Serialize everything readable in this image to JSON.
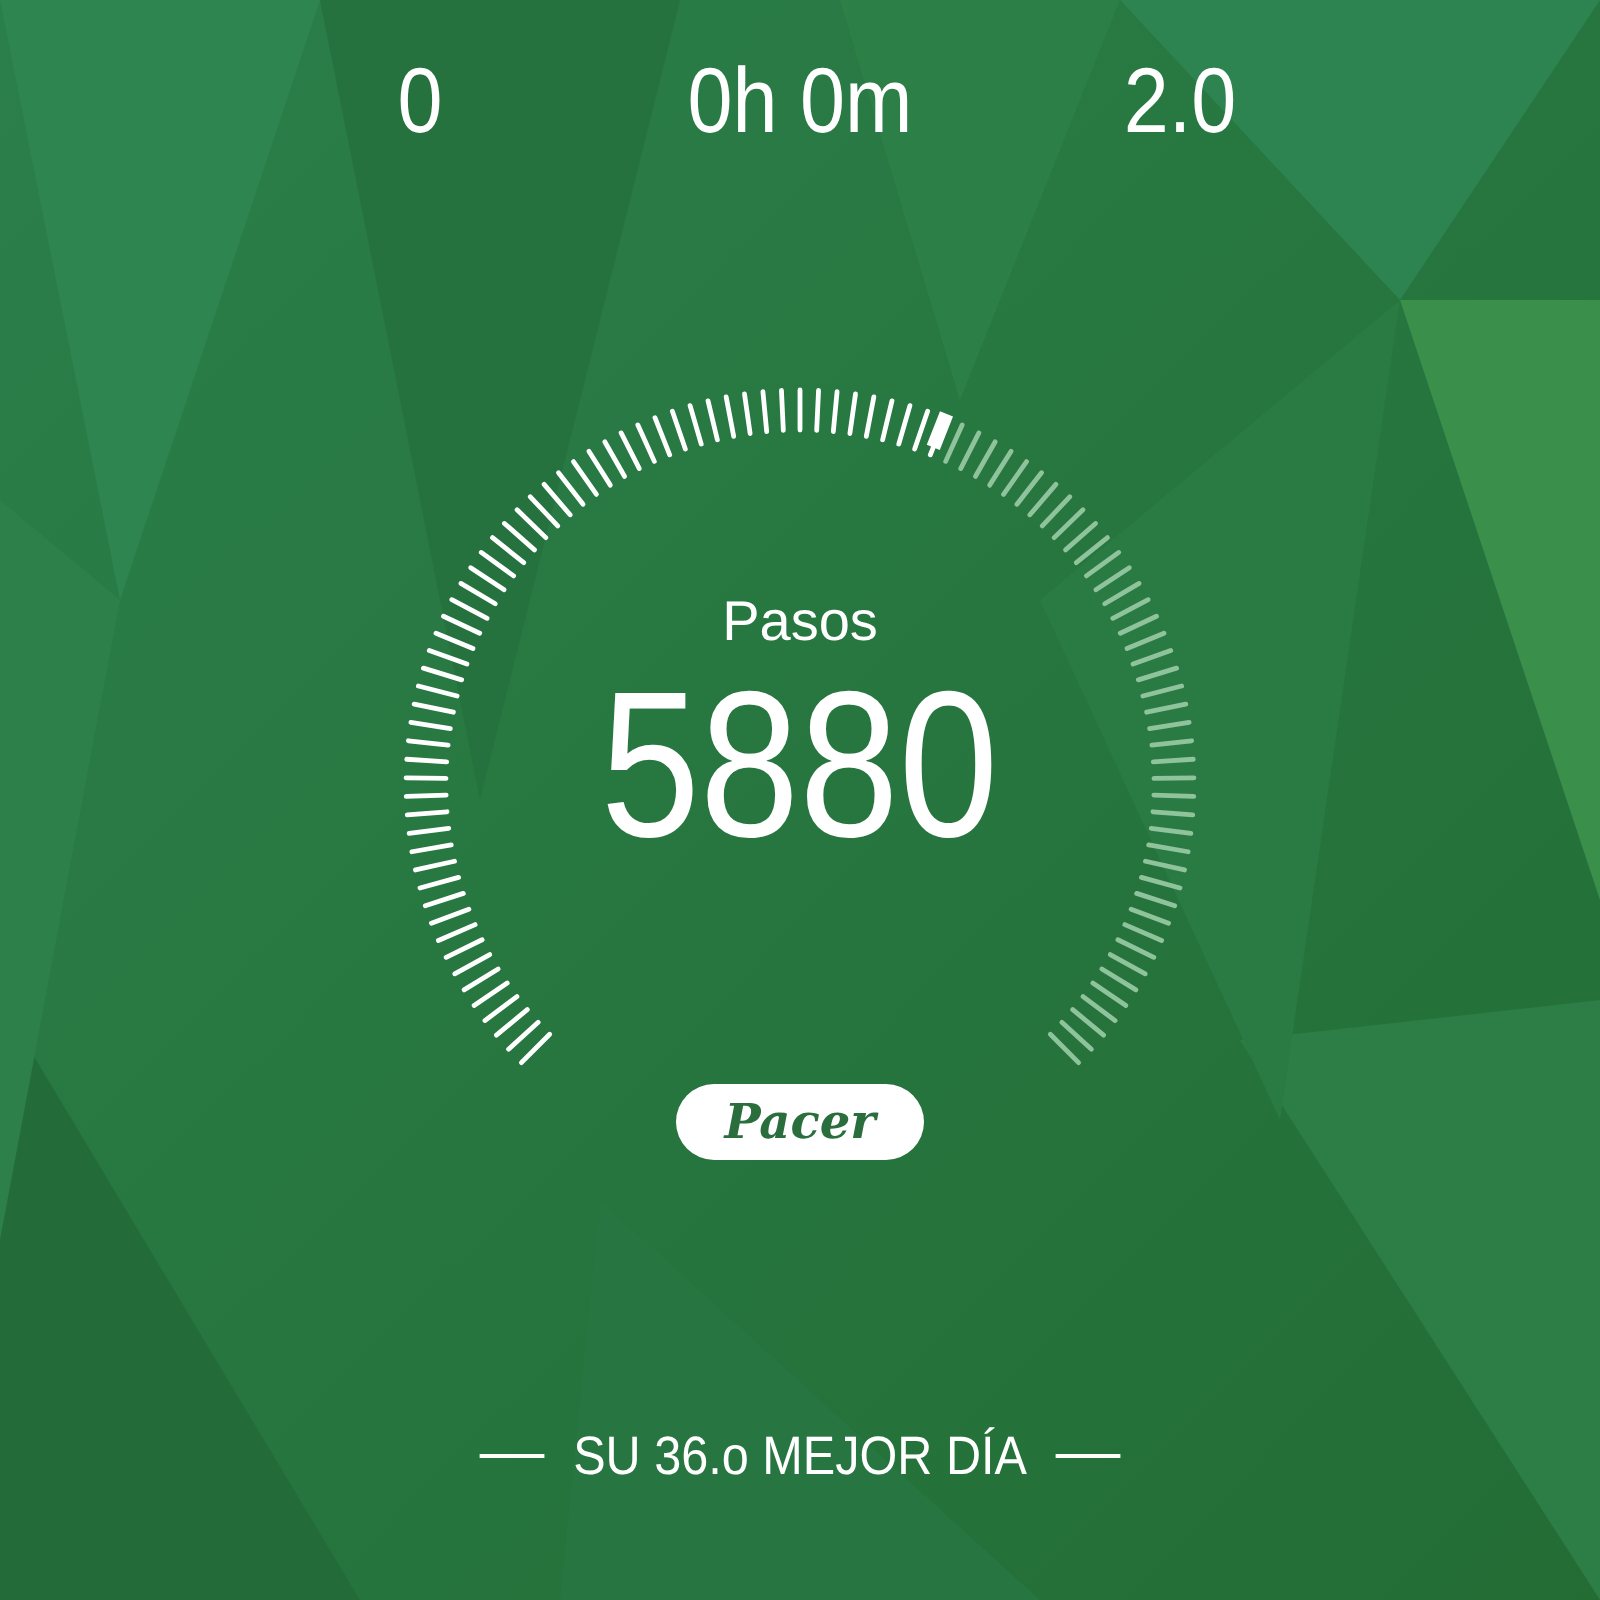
{
  "stats": [
    {
      "value": "0"
    },
    {
      "value": "0h 0m"
    },
    {
      "value": "2.0"
    }
  ],
  "gauge": {
    "label": "Pasos",
    "value": "5880"
  },
  "logo": "Pacer",
  "best_day": "SU 36.o MEJOR DÍA"
}
